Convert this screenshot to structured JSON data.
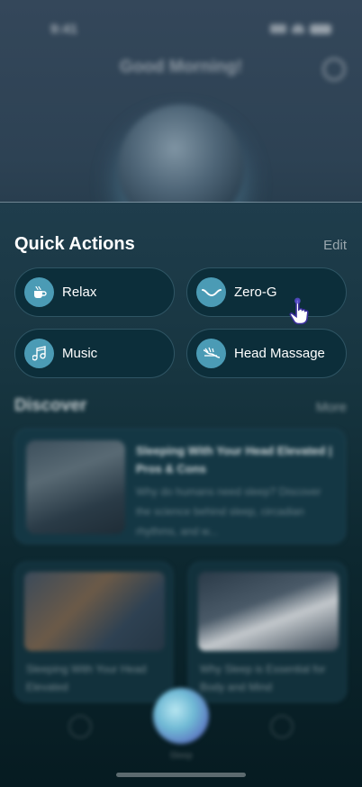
{
  "status_bar": {
    "time": "9:41"
  },
  "header": {
    "greeting": "Good Morning!"
  },
  "quick_actions": {
    "title": "Quick Actions",
    "edit_label": "Edit",
    "items": [
      {
        "label": "Relax",
        "icon": "coffee-cup-icon"
      },
      {
        "label": "Zero-G",
        "icon": "zero-gravity-curve-icon"
      },
      {
        "label": "Music",
        "icon": "music-note-icon"
      },
      {
        "label": "Head Massage",
        "icon": "head-massage-wave-icon"
      }
    ]
  },
  "discover": {
    "title": "Discover",
    "more_label": "More",
    "featured": {
      "title": "Sleeping With Your Head Elevated | Pros & Cons",
      "description": "Why do humans need sleep? Discover the science behind sleep, circadian rhythms, and w..."
    },
    "cards": [
      {
        "title": "Sleeping With Your Head Elevated"
      },
      {
        "title": "Why Sleep is Essential for Body and Mind"
      }
    ]
  },
  "tab_bar": {
    "center_label": "Sleep"
  },
  "colors": {
    "accent": "#4b9bb5",
    "pill_bg": "#0c2e3a",
    "cursor": "#5a4fcf"
  }
}
